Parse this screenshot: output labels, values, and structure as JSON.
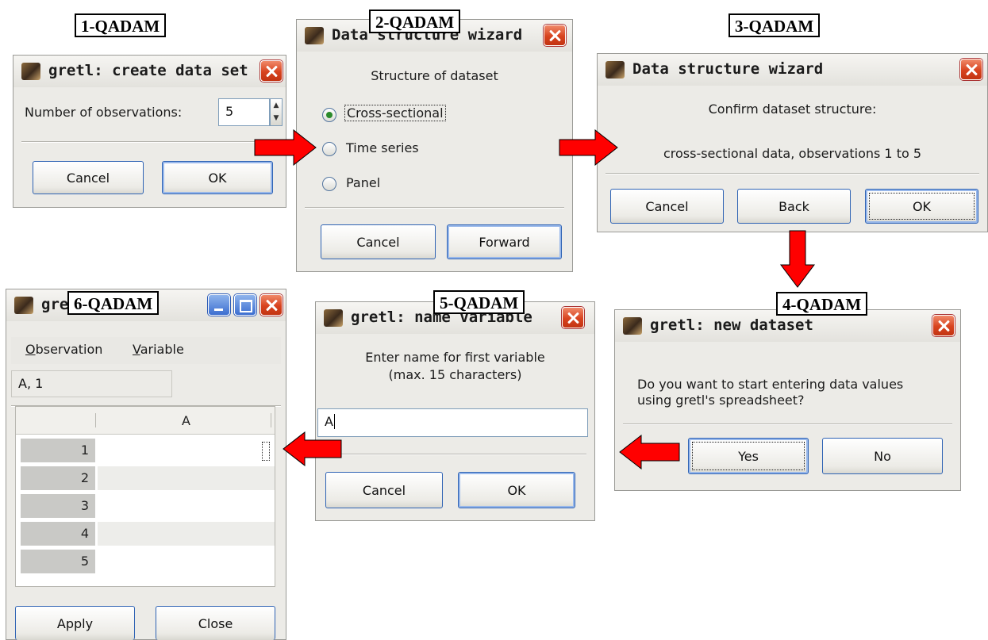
{
  "steps": {
    "step1": "1-QADAM",
    "step2": "2-QADAM",
    "step3": "3-QADAM",
    "step4": "4-QADAM",
    "step5": "5-QADAM",
    "step6": "6-QADAM"
  },
  "dialog1": {
    "title": "gretl: create data set",
    "obs_label": "Number of observations:",
    "obs_value": "5",
    "cancel": "Cancel",
    "ok": "OK"
  },
  "dialog2": {
    "title": "Data structure wizard",
    "heading": "Structure of dataset",
    "options": [
      "Cross-sectional",
      "Time series",
      "Panel"
    ],
    "selected": "Cross-sectional",
    "cancel": "Cancel",
    "forward": "Forward"
  },
  "dialog3": {
    "title": "Data structure wizard",
    "confirm": "Confirm dataset structure:",
    "summary": "cross-sectional data, observations 1 to 5",
    "cancel": "Cancel",
    "back": "Back",
    "ok": "OK"
  },
  "dialog4": {
    "title": "gretl: new dataset",
    "question_line1": "Do you want to start entering data values",
    "question_line2": "using gretl's spreadsheet?",
    "yes": "Yes",
    "no": "No"
  },
  "dialog5": {
    "title": "gretl: name variable",
    "prompt_line1": "Enter name for first variable",
    "prompt_line2": "(max. 15 characters)",
    "input_value": "A",
    "cancel": "Cancel",
    "ok": "OK"
  },
  "dialog6": {
    "title": "gre",
    "menu": [
      "Observation",
      "Variable"
    ],
    "cell_ref": "A, 1",
    "column_header": "A",
    "rows": [
      "1",
      "2",
      "3",
      "4",
      "5"
    ],
    "apply": "Apply",
    "close": "Close"
  },
  "colors": {
    "arrow": "#ff0000",
    "close_button": "#d8431f",
    "dialog_bg": "#ecebe7"
  }
}
